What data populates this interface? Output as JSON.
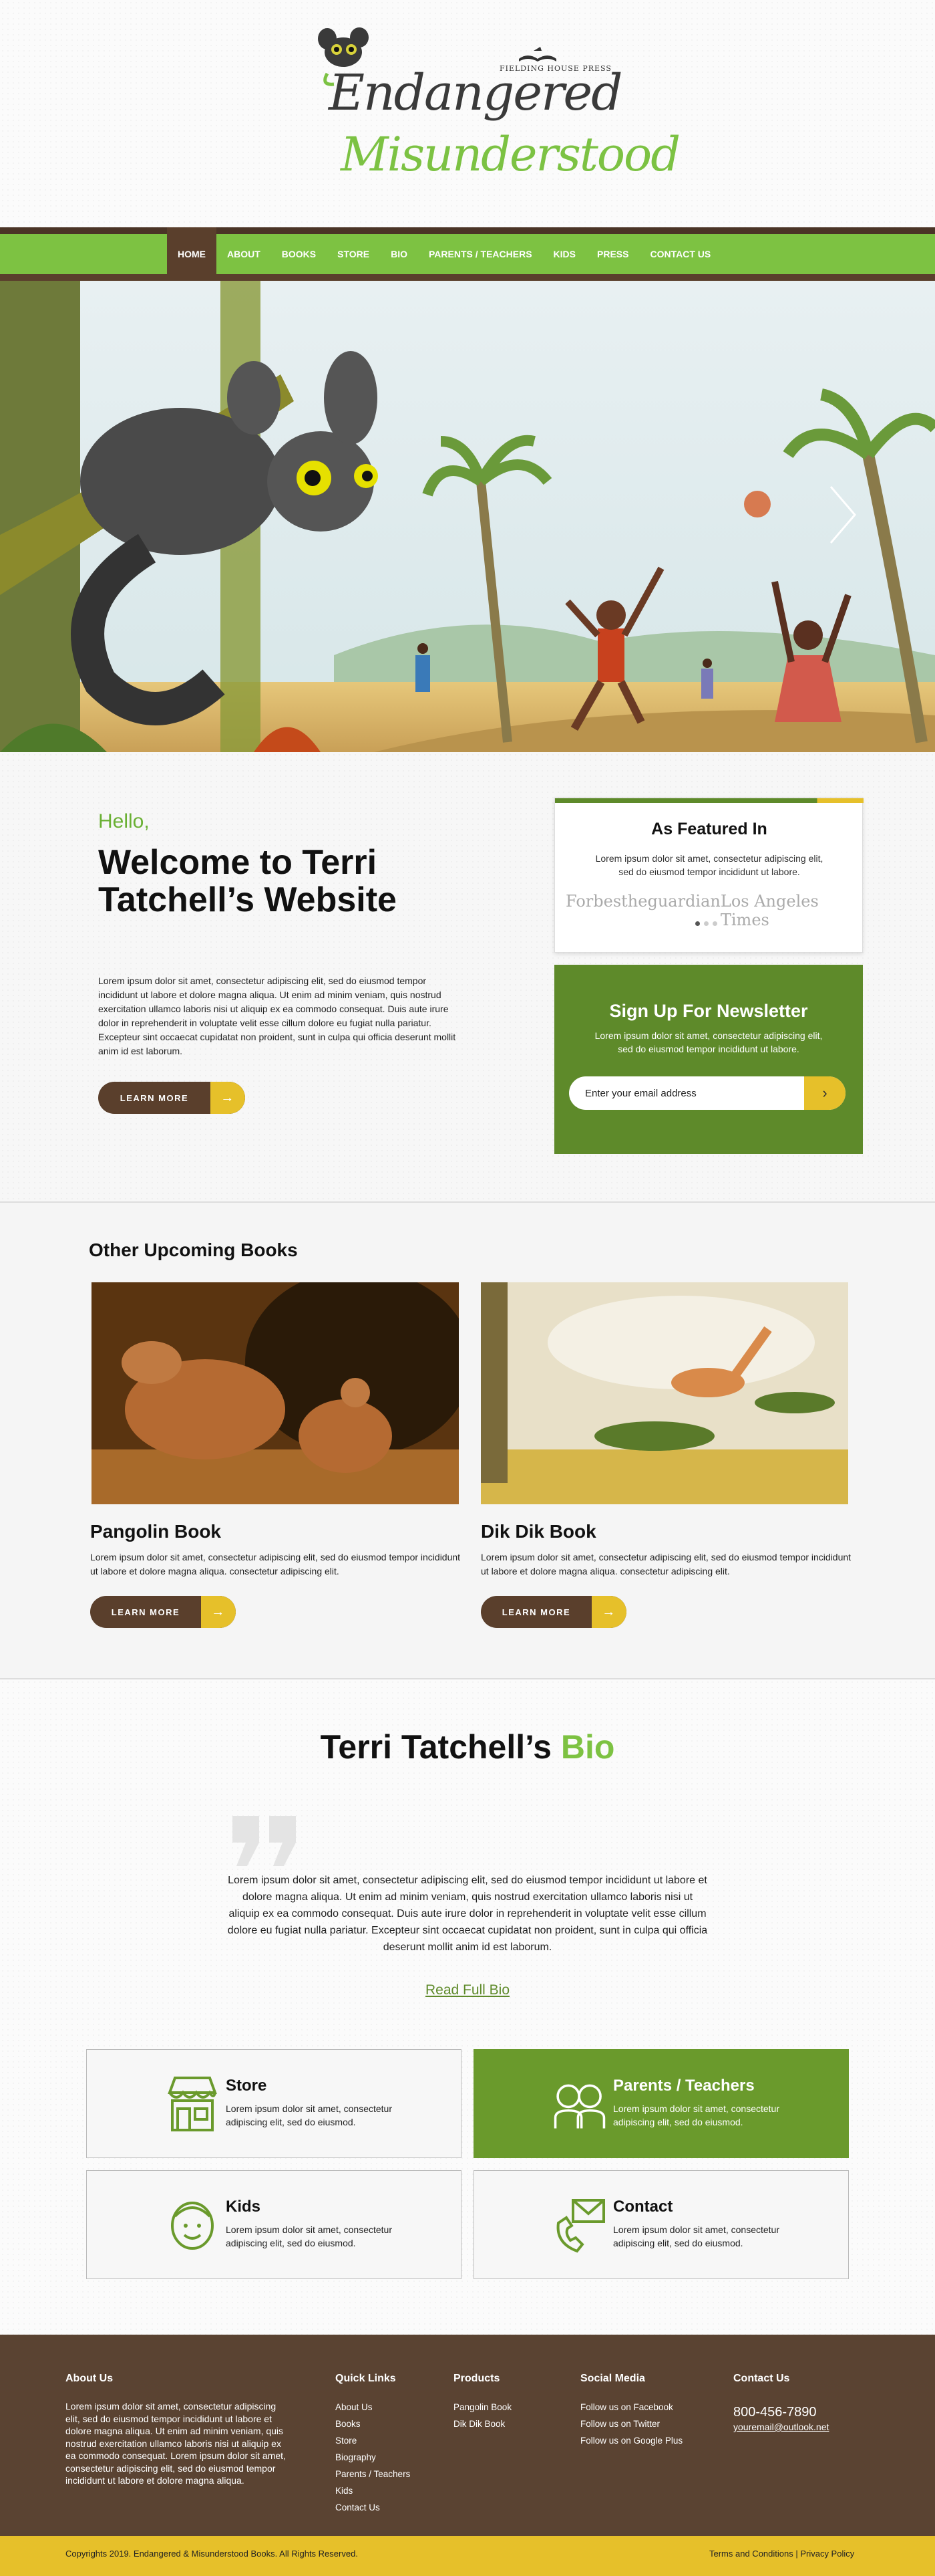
{
  "header": {
    "logo_line1": "Endangered",
    "logo_line2": "Misunderstood",
    "publisher": "FIELDING HOUSE PRESS"
  },
  "nav": {
    "items": [
      "HOME",
      "ABOUT",
      "BOOKS",
      "STORE",
      "BIO",
      "PARENTS / TEACHERS",
      "KIDS",
      "PRESS",
      "CONTACT US"
    ],
    "active": "HOME"
  },
  "hero": {
    "next_icon": "chevron-right-icon"
  },
  "welcome": {
    "hello": "Hello,",
    "title": "Welcome to Terri Tatchell’s Website",
    "text": "Lorem ipsum dolor sit amet, consectetur adipiscing elit, sed do eiusmod tempor incididunt ut labore et dolore magna aliqua. Ut enim ad minim veniam, quis nostrud exercitation ullamco laboris nisi ut aliquip ex ea commodo consequat. Duis aute irure dolor in reprehenderit in voluptate velit esse cillum dolore eu fugiat nulla pariatur. Excepteur sint occaecat cupidatat non proident, sunt in culpa qui officia deserunt mollit anim id est laborum.",
    "button": "LEARN MORE"
  },
  "featured": {
    "title": "As Featured In",
    "text": "Lorem ipsum dolor sit amet, consectetur adipiscing elit, sed do eiusmod tempor incididunt ut labore.",
    "logos": [
      "Forbes",
      "theguardian",
      "Los Angeles Times"
    ]
  },
  "newsletter": {
    "title": "Sign Up For Newsletter",
    "text": "Lorem ipsum dolor sit amet, consectetur adipiscing elit, sed do eiusmod tempor incididunt ut labore.",
    "placeholder": "Enter your email address"
  },
  "upcoming": {
    "title": "Other Upcoming Books",
    "books": [
      {
        "title": "Pangolin Book",
        "text": "Lorem ipsum dolor sit amet, consectetur adipiscing elit, sed do eiusmod tempor incididunt ut labore et dolore magna aliqua. consectetur adipiscing elit.",
        "button": "LEARN MORE"
      },
      {
        "title": "Dik Dik Book",
        "text": "Lorem ipsum dolor sit amet, consectetur adipiscing elit, sed do eiusmod tempor incididunt ut labore et dolore magna aliqua. consectetur adipiscing elit.",
        "button": "LEARN MORE"
      }
    ]
  },
  "bio": {
    "title_main": "Terri Tatchell’s",
    "title_accent": "Bio",
    "text": "Lorem ipsum dolor sit amet, consectetur adipiscing elit, sed do eiusmod tempor incididunt ut labore et dolore magna aliqua. Ut enim ad minim veniam, quis nostrud exercitation ullamco laboris nisi ut aliquip ex ea commodo consequat. Duis aute irure dolor in reprehenderit in voluptate velit esse cillum dolore eu fugiat nulla pariatur. Excepteur sint occaecat cupidatat non proident, sunt in culpa qui officia deserunt mollit anim id est laborum.",
    "link": "Read Full Bio"
  },
  "cards": [
    {
      "title": "Store",
      "text": "Lorem ipsum dolor sit amet, consectetur adipiscing elit, sed do eiusmod.",
      "icon": "store-icon"
    },
    {
      "title": "Parents / Teachers",
      "text": "Lorem ipsum dolor sit amet, consectetur adipiscing elit, sed do eiusmod.",
      "icon": "parents-icon"
    },
    {
      "title": "Kids",
      "text": "Lorem ipsum dolor sit amet, consectetur adipiscing elit, sed do eiusmod.",
      "icon": "kid-icon"
    },
    {
      "title": "Contact",
      "text": "Lorem ipsum dolor sit amet, consectetur adipiscing elit, sed do eiusmod.",
      "icon": "contact-icon"
    }
  ],
  "footer": {
    "about_title": "About Us",
    "about_text": "Lorem ipsum dolor sit amet, consectetur adipiscing elit, sed do eiusmod tempor incididunt ut labore et dolore magna aliqua. Ut enim ad minim veniam, quis nostrud exercitation ullamco laboris nisi ut aliquip ex ea commodo consequat. Lorem ipsum dolor sit amet, consectetur adipiscing elit, sed do eiusmod tempor incididunt ut labore et dolore magna aliqua.",
    "quick_title": "Quick Links",
    "quick": [
      "About Us",
      "Books",
      "Store",
      "Biography",
      "Parents / Teachers",
      "Kids",
      "Contact Us"
    ],
    "products_title": "Products",
    "products": [
      "Pangolin Book",
      "Dik Dik Book"
    ],
    "social_title": "Social Media",
    "social": [
      "Follow us on Facebook",
      "Follow us on Twitter",
      "Follow us on Google Plus"
    ],
    "contact_title": "Contact Us",
    "phone": "800-456-7890",
    "email": "youremail@outlook.net",
    "copyright": "Copyrights 2019. Endangered & Misunderstood Books. All Rights Reserved.",
    "legal": "Terms and Conditions | Privacy Policy"
  },
  "colors": {
    "green": "#7dc242",
    "dark_green": "#5e8a2a",
    "brown": "#5a3f2c",
    "yellow": "#e6c02a"
  }
}
